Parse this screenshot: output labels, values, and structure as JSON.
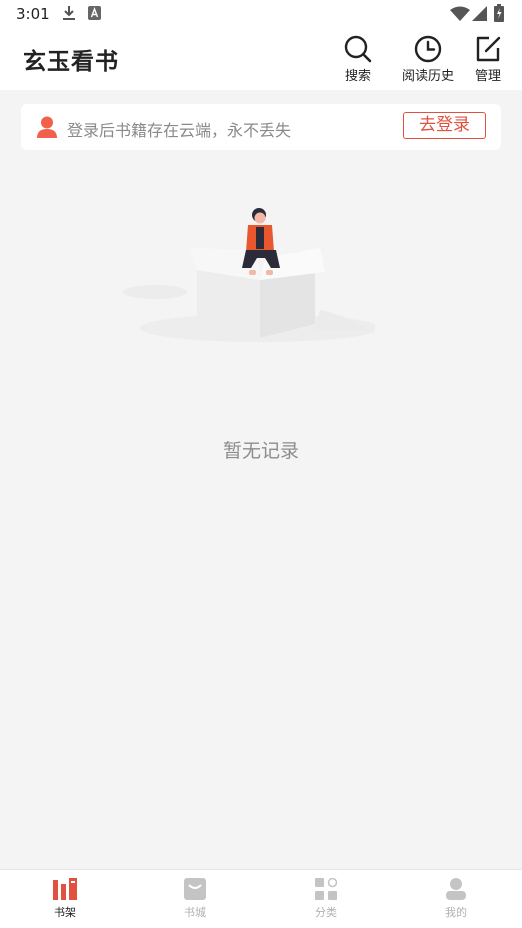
{
  "status_bar": {
    "time": "3:01",
    "icons": [
      "download-icon",
      "text-a-icon",
      "wifi-icon",
      "signal-icon",
      "battery-charging-icon"
    ]
  },
  "header": {
    "title": "玄玉看书",
    "actions": [
      {
        "label": "搜索",
        "icon": "search-icon"
      },
      {
        "label": "阅读历史",
        "icon": "clock-icon"
      },
      {
        "label": "管理",
        "icon": "edit-icon"
      }
    ]
  },
  "login_banner": {
    "hint": "登录后书籍存在云端，永不丢失",
    "button_label": "去登录",
    "icon": "user-icon"
  },
  "empty_state": {
    "text": "暂无记录",
    "icon": "empty-box-illustration"
  },
  "bottom_nav": {
    "items": [
      {
        "label": "书架",
        "icon": "bookshelf-icon",
        "active": true
      },
      {
        "label": "书城",
        "icon": "bookstore-icon",
        "active": false
      },
      {
        "label": "分类",
        "icon": "category-icon",
        "active": false
      },
      {
        "label": "我的",
        "icon": "profile-icon",
        "active": false
      }
    ]
  },
  "colors": {
    "accent": "#e0523f",
    "background": "#f4f4f4",
    "nav_inactive": "#c4c4c4",
    "hint_text": "#8a8a8a"
  }
}
